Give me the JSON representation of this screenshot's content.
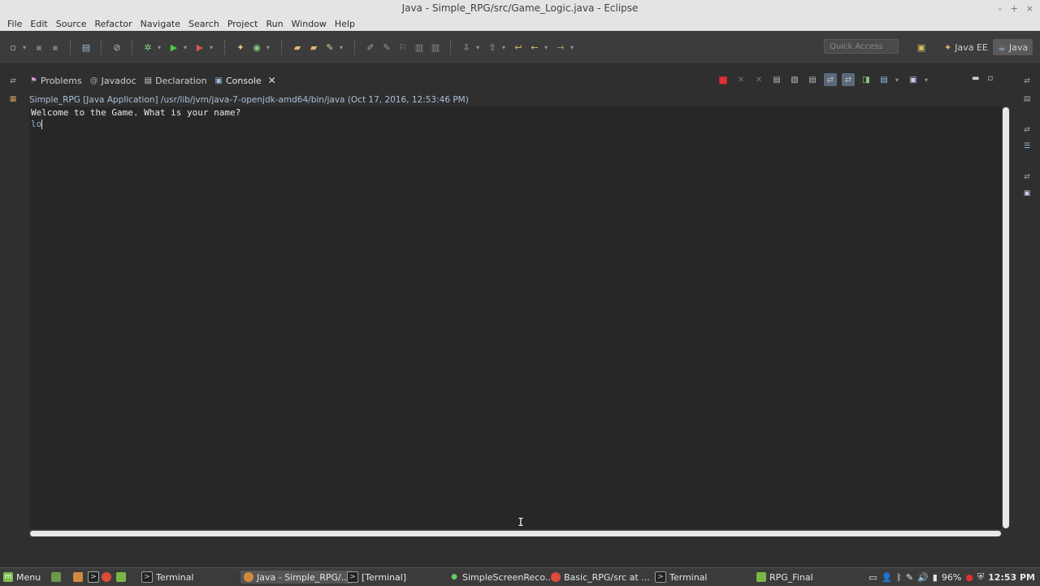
{
  "window": {
    "title": "Java - Simple_RPG/src/Game_Logic.java - Eclipse"
  },
  "menubar": [
    "File",
    "Edit",
    "Source",
    "Refactor",
    "Navigate",
    "Search",
    "Project",
    "Run",
    "Window",
    "Help"
  ],
  "toolbar": {
    "quick_access_placeholder": "Quick Access",
    "perspectives": {
      "java_ee": "Java EE",
      "java": "Java"
    }
  },
  "view_tabs": {
    "problems": "Problems",
    "javadoc": "Javadoc",
    "declaration": "Declaration",
    "console": "Console"
  },
  "console": {
    "header": "Simple_RPG [Java Application] /usr/lib/jvm/java-7-openjdk-amd64/bin/java (Oct 17, 2016, 12:53:46 PM)",
    "output": "Welcome to the Game. What is your name?",
    "input": "lo"
  },
  "taskbar": {
    "menu": "Menu",
    "items": {
      "terminal1": "Terminal",
      "eclipse": "Java - Simple_RPG/...",
      "terminal2": "[Terminal]",
      "recorder": "SimpleScreenReco...",
      "browser": "Basic_RPG/src at ...",
      "terminal3": "Terminal",
      "folder": "RPG_Final"
    },
    "battery": "96%",
    "clock": "12:53 PM"
  },
  "colors": {
    "background": "#2f2f2f",
    "console_bg": "#272727",
    "console_input": "#8fb0d0",
    "stop_red": "#e03030"
  }
}
